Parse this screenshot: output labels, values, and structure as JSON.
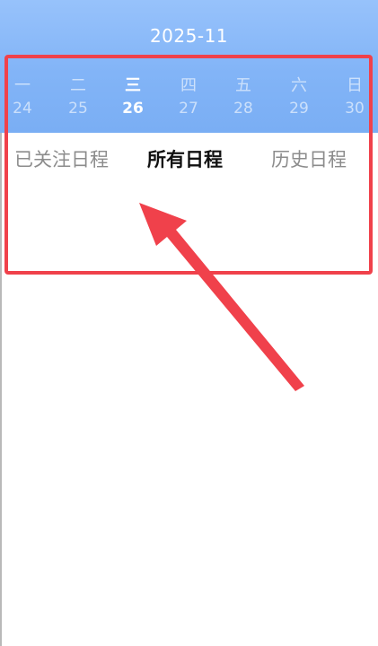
{
  "header": {
    "month": "2025-11"
  },
  "week": [
    {
      "weekday": "一",
      "date": "24",
      "active": false
    },
    {
      "weekday": "二",
      "date": "25",
      "active": false
    },
    {
      "weekday": "三",
      "date": "26",
      "active": true
    },
    {
      "weekday": "四",
      "date": "27",
      "active": false
    },
    {
      "weekday": "五",
      "date": "28",
      "active": false
    },
    {
      "weekday": "六",
      "date": "29",
      "active": false
    },
    {
      "weekday": "日",
      "date": "30",
      "active": false
    }
  ],
  "tabs": [
    {
      "label": "已关注日程",
      "selected": false
    },
    {
      "label": "所有日程",
      "selected": true
    },
    {
      "label": "历史日程",
      "selected": false
    }
  ],
  "colors": {
    "header_top": "#97c2fb",
    "header_bottom": "#7aaef4",
    "annotation": "#f0414b",
    "tab_selected": "#111111",
    "tab_normal": "#8c8c8c"
  }
}
